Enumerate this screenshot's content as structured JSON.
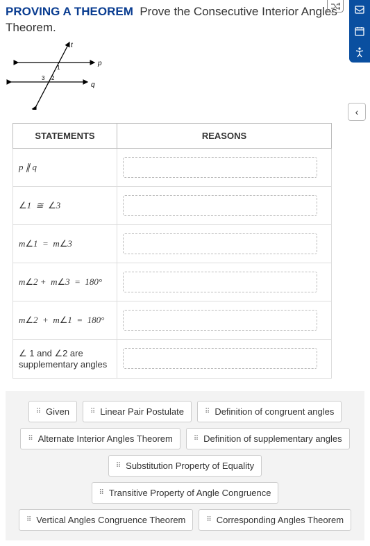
{
  "header": {
    "heading": "PROVING A THEOREM",
    "prompt": "Prove the Consecutive Interior Angles Theorem."
  },
  "diagram": {
    "label_t": "t",
    "label_p": "p",
    "label_q": "q",
    "angle1": "1",
    "angle2": "2",
    "angle3": "3"
  },
  "table": {
    "col1": "STATEMENTS",
    "col2": "REASONS",
    "rows": [
      {
        "stmt_html": "p ∥ q"
      },
      {
        "stmt_html": "∠1 ≅ ∠3"
      },
      {
        "stmt_html": "m∠1 = m∠3"
      },
      {
        "stmt_html": "m∠2 + m∠3 = 180°"
      },
      {
        "stmt_html": "m∠2 + m∠1 = 180°"
      },
      {
        "stmt_html": "∠1 and ∠2 are supplementary angles",
        "upright": true
      }
    ]
  },
  "answers": [
    "Given",
    "Linear Pair Postulate",
    "Definition of congruent angles",
    "Alternate Interior Angles Theorem",
    "Definition of supplementary angles",
    "Substitution Property of Equality",
    "Transitive Property of Angle Congruence",
    "Vertical Angles Congruence Theorem",
    "Corresponding Angles Theorem"
  ]
}
